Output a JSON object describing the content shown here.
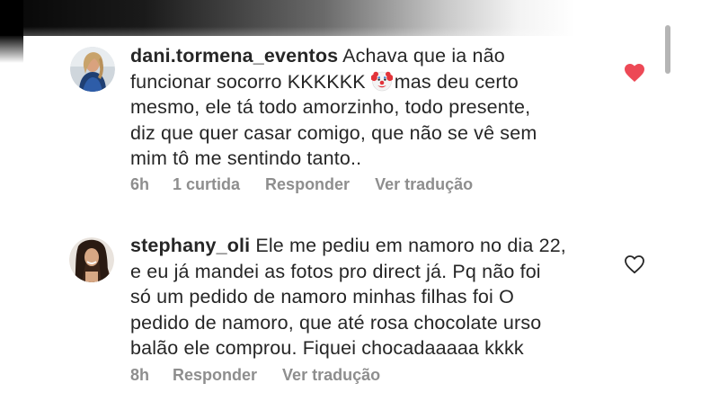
{
  "comments": [
    {
      "username": "dani.tormena_eventos",
      "line1_text": "Achava que ia não",
      "line2_text_before_emoji": "funcionar socorro KKKKKK",
      "emoji": "clown-face-emoji",
      "line2_text_after_emoji": "mas deu certo",
      "line3": "mesmo, ele tá todo amorzinho, todo presente,",
      "line4": "diz que quer casar comigo, que não se vê sem",
      "line5": "mim tô me sentindo tanto..",
      "time": "6h",
      "likes": "1 curtida",
      "reply_label": "Responder",
      "translate_label": "Ver tradução",
      "liked": true,
      "like_color": "#ed4956"
    },
    {
      "username": "stephany_oli",
      "line1_text": "Ele me pediu em namoro no dia 22,",
      "line2": "e eu já mandei as fotos pro direct já. Pq não foi",
      "line3": "só um pedido de namoro minhas filhas foi O",
      "line4": "pedido de namoro, que até rosa chocolate urso",
      "line5": "balão ele comprou. Fiquei chocadaaaaa kkkk",
      "time": "8h",
      "reply_label": "Responder",
      "translate_label": "Ver tradução",
      "liked": false
    }
  ],
  "colors": {
    "text": "#262626",
    "secondary": "#8e8e8e",
    "like_active": "#ed4956",
    "scrollbar": "#b5b5b5"
  }
}
